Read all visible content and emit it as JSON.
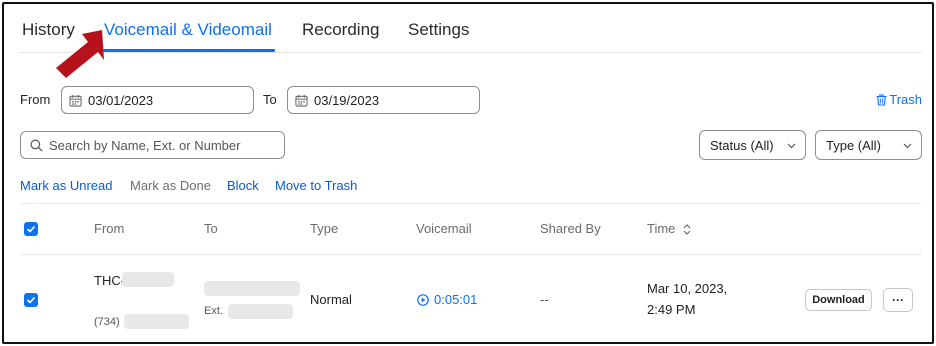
{
  "tabs": [
    {
      "label": "History",
      "active": false
    },
    {
      "label": "Voicemail & Videomail",
      "active": true
    },
    {
      "label": "Recording",
      "active": false
    },
    {
      "label": "Settings",
      "active": false
    }
  ],
  "filters": {
    "from_label": "From",
    "from_date": "03/01/2023",
    "to_label": "To",
    "to_date": "03/19/2023",
    "trash_label": "Trash",
    "search_placeholder": "Search by Name, Ext. or Number",
    "status_select": "Status (All)",
    "type_select": "Type (All)"
  },
  "actions": {
    "mark_unread": "Mark as Unread",
    "mark_done": "Mark as Done",
    "block": "Block",
    "move_to_trash": "Move to Trash"
  },
  "table": {
    "header_checked": true,
    "columns": {
      "from": "From",
      "to": "To",
      "type": "Type",
      "voicemail": "Voicemail",
      "shared_by": "Shared By",
      "time": "Time"
    },
    "rows": [
      {
        "checked": true,
        "from_name": "THC-",
        "from_number": "(734)",
        "to_ext_label": "Ext.",
        "type": "Normal",
        "voicemail_duration": "0:05:01",
        "shared_by": "--",
        "time_date": "Mar 10, 2023,",
        "time_clock": "2:49 PM",
        "download_label": "Download",
        "more_label": "···"
      }
    ]
  },
  "colors": {
    "accent": "#0e72ed",
    "annotation_arrow": "#b5121b"
  },
  "icons": [
    "calendar-icon",
    "trash-icon",
    "search-icon",
    "chevron-down-icon",
    "checkmark-icon",
    "sort-icon",
    "play-circle-icon",
    "more-icon",
    "annotation-arrow"
  ]
}
